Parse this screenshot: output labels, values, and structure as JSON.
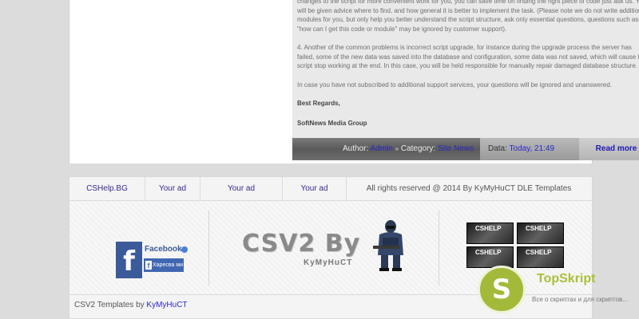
{
  "article": {
    "paragraphs": [
      "changes to the script for more convenient work for you, you can save time on finding the right piece of code just ask us. You will be given advice where to find, and how general it is better to implement the task. (Please note we do not write additional modules for you, but only help you better understand the script structure, ask only essential questions, questions such as: \"how can I get this code or module\" may be ignored by customer support).",
      "4. Another of the common problems is incorrect script upgrade, for instance during the upgrade process the server has failed, some of the new data was saved into the database and configuration, some data was not saved, which will cause the script stop working at the end. In this case, you will be held responsible for manually repair damaged database structure.",
      "In case you have not subscribed to additional support services, your questions will be ignored and unanswered."
    ],
    "regards": "Best Regards,",
    "team": "SoftNews Media Group"
  },
  "meta": {
    "author_label": "Author:",
    "author": "Admin",
    "separator": "»",
    "category_label": "Category:",
    "category": "Site News",
    "date_label": "Data:",
    "date": "Today, 21:49",
    "read_more": "Read more"
  },
  "footer_nav": {
    "items": [
      "CSHelp.BG",
      "Your ad",
      "Your ad",
      "Your ad"
    ],
    "copyright": "All rights reserved @ 2014 By KyMyHuCT DLE Templates"
  },
  "facebook": {
    "title": "Facebook",
    "like_label": "Харесва ми"
  },
  "logo": {
    "title": "CSV2 By",
    "subtitle": "KyMyHuCT"
  },
  "banners": [
    "CSHELP",
    "CSHELP",
    "CSHELP",
    "CSHELP"
  ],
  "footer_bottom": {
    "text": "CSV2 Templates by",
    "author": "KyMyHuCT"
  },
  "watermark": {
    "letter": "S",
    "title": "TopSkript",
    "subtitle": "Все о скриптах и для скриптов..."
  },
  "colors": {
    "link": "#2a28c8",
    "facebook": "#3b5a9a",
    "watermark": "#a2b93a"
  }
}
